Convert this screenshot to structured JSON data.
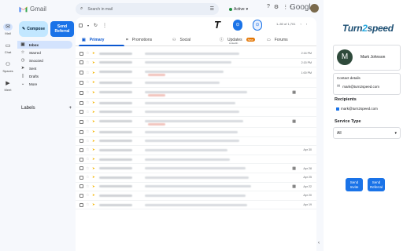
{
  "rail": [
    {
      "label": "Mail",
      "icon": "mail-icon",
      "active": true
    },
    {
      "label": "Chat",
      "icon": "chat-icon"
    },
    {
      "label": "Spaces",
      "icon": "spaces-icon"
    },
    {
      "label": "Meet",
      "icon": "meet-icon"
    }
  ],
  "app": {
    "name": "Gmail"
  },
  "sidebar": {
    "compose_label": "Compose",
    "send_referral_label": "Send Referral",
    "items": [
      {
        "label": "Inbox",
        "icon": "inbox-icon"
      },
      {
        "label": "Starred",
        "icon": "star-icon"
      },
      {
        "label": "Snoozed",
        "icon": "clock-icon"
      },
      {
        "label": "Sent",
        "icon": "send-icon"
      },
      {
        "label": "Drafts",
        "icon": "draft-icon"
      },
      {
        "label": "More",
        "icon": "chevron-down-icon"
      }
    ],
    "labels_heading": "Labels",
    "labels_add": "+"
  },
  "search": {
    "placeholder": "Search in mail"
  },
  "header": {
    "status": "Active",
    "brand": "Google"
  },
  "pager": {
    "range": "1–50 of 1,701",
    "prev": "‹",
    "next": "›"
  },
  "tabs": [
    {
      "label": "Primary",
      "icon": "inbox-icon",
      "active": true
    },
    {
      "label": "Promotions",
      "icon": "tag-icon"
    },
    {
      "label": "Social",
      "icon": "people-icon"
    },
    {
      "label": "Updates",
      "icon": "info-icon",
      "badge": "New",
      "sub": "LinkedIn"
    },
    {
      "label": "Forums",
      "icon": "forum-icon"
    }
  ],
  "emails": [
    {
      "date": "2:16 PM"
    },
    {
      "date": "2:15 PM"
    },
    {
      "date": "1:00 PM",
      "chip": true,
      "tall": true
    },
    {
      "date": ""
    },
    {
      "date": "",
      "cal": true,
      "chip": true,
      "tall": true
    },
    {
      "date": ""
    },
    {
      "date": ""
    },
    {
      "date": "",
      "cal": true,
      "chip": true,
      "tall": true
    },
    {
      "date": ""
    },
    {
      "date": ""
    },
    {
      "date": "Apr 30"
    },
    {
      "date": ""
    },
    {
      "date": "Apr 28",
      "cal": true
    },
    {
      "date": "Apr 25"
    },
    {
      "date": "Apr 22",
      "cal": true
    },
    {
      "date": "Apr 20"
    },
    {
      "date": "Apr 19"
    }
  ],
  "panel": {
    "logo_main": "Turn",
    "logo_accent": "2",
    "logo_end": "speed",
    "contact_initial": "M",
    "contact_name": "Mark Johnson",
    "contact_details_heading": "Contact details",
    "contact_email": "mark@turn2speed.com",
    "recipients_heading": "Recipients",
    "recipient_email": "mark@turn2speed.com",
    "service_heading": "Service Type",
    "service_value": "All",
    "send_invite_label": "Send Invite",
    "send_referral_label": "Send Referral"
  },
  "colors": {
    "accent": "#1a73e8",
    "compose": "#c2e7ff",
    "inbox_active": "#d3e3fd",
    "brand": "#1d4f73"
  }
}
